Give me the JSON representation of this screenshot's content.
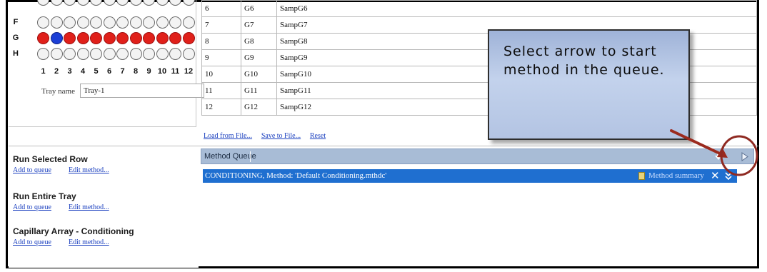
{
  "plate": {
    "row_letters": [
      "F",
      "G",
      "H"
    ],
    "column_numbers": [
      "1",
      "2",
      "3",
      "4",
      "5",
      "6",
      "7",
      "8",
      "9",
      "10",
      "11",
      "12"
    ],
    "tray_label": "Tray name",
    "tray_name": "Tray-1",
    "well_colors": {
      "empty": "#f3f3f3",
      "filled": "#e0201a",
      "selected": "#1c3fd6"
    }
  },
  "sample_table": {
    "rows": [
      [
        "6",
        "G6",
        "SampG6"
      ],
      [
        "7",
        "G7",
        "SampG7"
      ],
      [
        "8",
        "G8",
        "SampG8"
      ],
      [
        "9",
        "G9",
        "SampG9"
      ],
      [
        "10",
        "G10",
        "SampG10"
      ],
      [
        "11",
        "G11",
        "SampG11"
      ],
      [
        "12",
        "G12",
        "SampG12"
      ]
    ],
    "links": [
      "Load from File...",
      "Save to File...",
      "Reset"
    ]
  },
  "run_panel": {
    "sections": [
      {
        "title": "Run Selected Row",
        "add": "Add to queue",
        "edit": "Edit method..."
      },
      {
        "title": "Run Entire Tray",
        "add": "Add to queue",
        "edit": "Edit method..."
      },
      {
        "title": "Capillary Array - Conditioning",
        "add": "Add to queue",
        "edit": "Edit method..."
      }
    ]
  },
  "method_queue": {
    "title": "Method Queue",
    "item_text": "CONDITIONING, Method: 'Default Conditioning.mthdc'",
    "summary_label": "Method summary",
    "header_color": "#a8bcd6",
    "item_color": "#1f6fd0"
  },
  "callout": {
    "text": "Select arrow to start method in the queue."
  },
  "accent_colors": {
    "annotation": "#9b2a1e"
  }
}
